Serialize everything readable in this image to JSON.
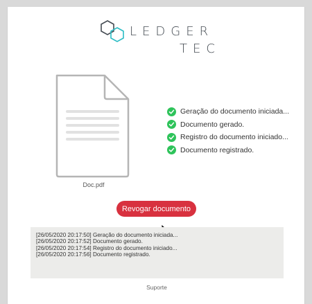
{
  "logo": {
    "line1": "LEDGER",
    "line2": "TEC",
    "mark_colors": {
      "dark": "#444b52",
      "accent": "#2bbcc4"
    }
  },
  "document": {
    "icon": "document-icon",
    "filename": "Doc.pdf"
  },
  "steps": [
    {
      "label": "Geração do documento iniciada...",
      "icon": "check-circle-icon"
    },
    {
      "label": "Documento gerado.",
      "icon": "check-circle-icon"
    },
    {
      "label": "Registro do documento iniciado...",
      "icon": "check-circle-icon"
    },
    {
      "label": "Documento registrado.",
      "icon": "check-circle-icon"
    }
  ],
  "revoke_button": {
    "label": "Revogar documento",
    "color": "#d8313f"
  },
  "log": [
    "[26/05/2020 20:17:50] Geração do documento iniciada...",
    "[26/05/2020 20:17:52] Documento gerado.",
    "[26/05/2020 20:17:54] Registro do documento iniciado...",
    "[26/05/2020 20:17:56] Documento registrado."
  ],
  "footer": {
    "support_link": "Suporte"
  },
  "colors": {
    "success": "#2ec35a",
    "log_bg": "#ececea"
  }
}
